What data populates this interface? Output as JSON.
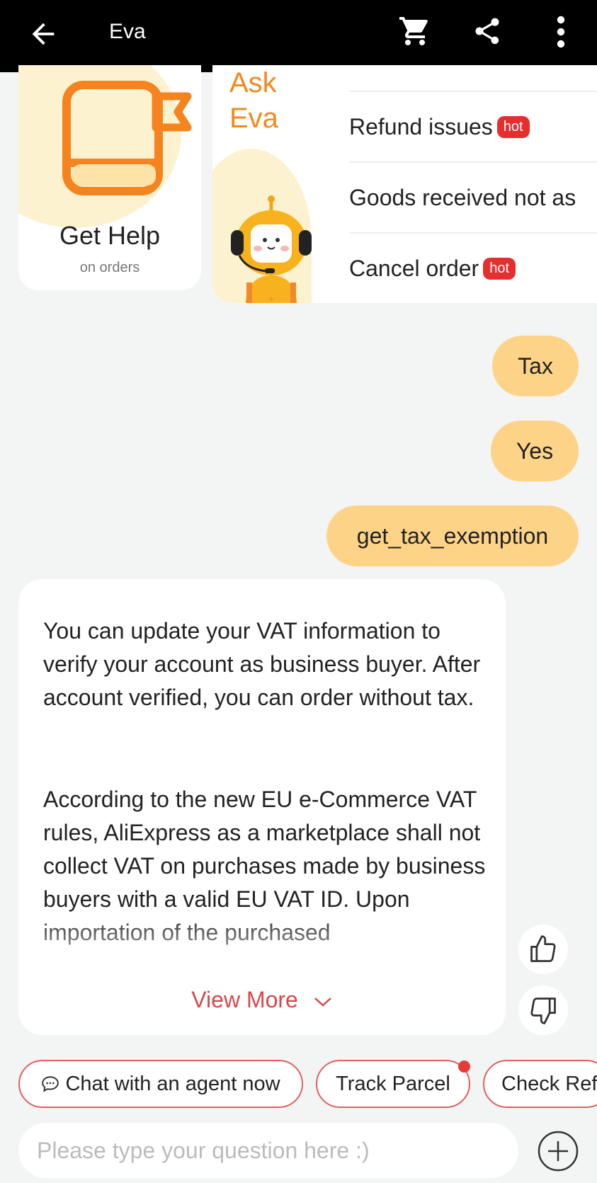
{
  "header": {
    "title": "Eva",
    "icons": [
      "back-arrow-icon",
      "cart-icon",
      "share-icon",
      "more-vert-icon"
    ]
  },
  "cards": {
    "get_help": {
      "title": "Get Help",
      "subtitle": "on orders"
    },
    "ask_eva": {
      "title_line1": "Ask",
      "title_line2": "Eva",
      "questions": [
        {
          "label": "Refund issues",
          "badge": "hot"
        },
        {
          "label": "Goods received not as",
          "badge": ""
        },
        {
          "label": "Cancel order",
          "badge": "hot"
        }
      ]
    }
  },
  "messages": {
    "user": [
      "Tax",
      "Yes",
      "get_tax_exemption"
    ],
    "bot": {
      "paragraph1": "You can update your VAT information to verify your account as business buyer. After account verified, you can order without tax.",
      "paragraph2": "According to the new EU e-Commerce VAT rules, AliExpress as a marketplace shall not collect VAT on purchases made by business buyers with a valid EU VAT ID. Upon importation of the purchased",
      "view_more": "View More"
    }
  },
  "quick_actions": [
    "Chat with an agent now",
    "Track Parcel",
    "Check Ref"
  ],
  "composer": {
    "placeholder": "Please type your question here :)"
  },
  "colors": {
    "accent": "#f08a1e",
    "bubble": "#fdd388",
    "chip_border": "#e0605f",
    "hot": "#e62e2e"
  }
}
